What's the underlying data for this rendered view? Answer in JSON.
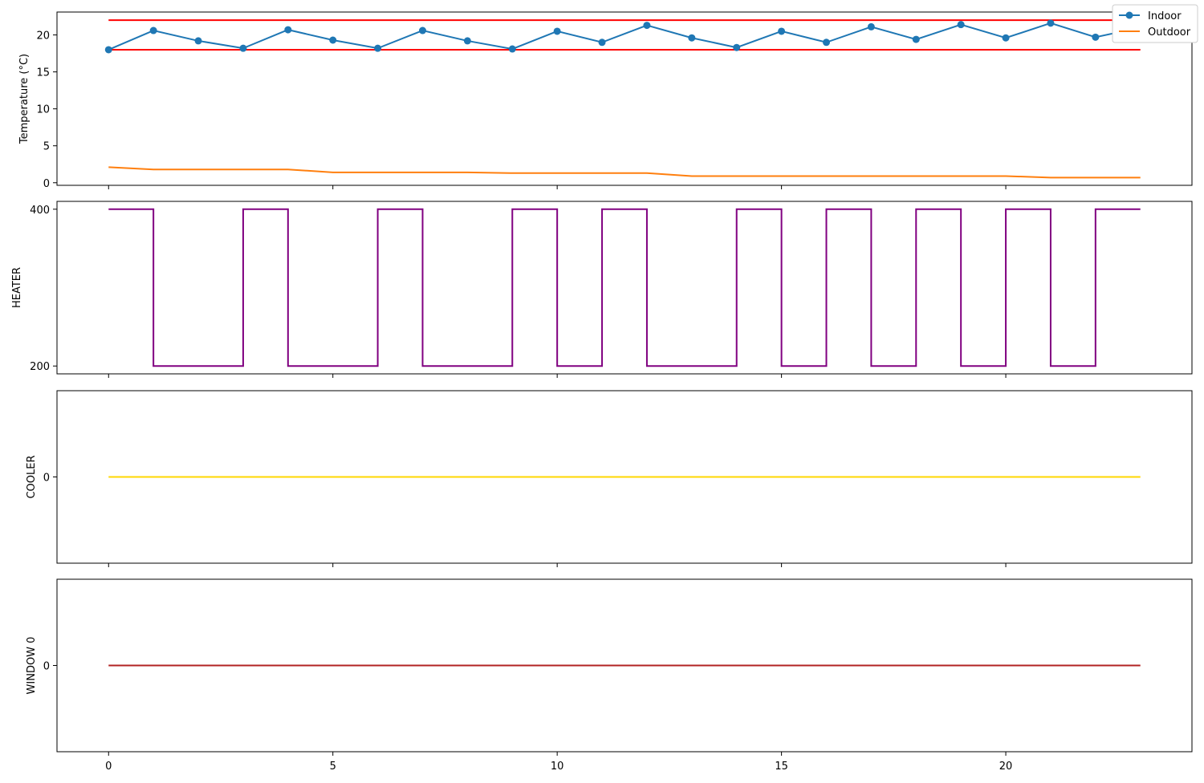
{
  "chart_data": [
    {
      "type": "line",
      "panel": "temperature",
      "ylabel": "Temperature (°C)",
      "xlabel": "",
      "xlim": [
        -1.15,
        24.15
      ],
      "ylim": [
        -0.35,
        23.1
      ],
      "x_ticks": [
        0,
        5,
        10,
        15,
        20
      ],
      "y_ticks": [
        0,
        5,
        10,
        15,
        20
      ],
      "show_x_tick_labels": false,
      "legend_position": "top-right",
      "grid": false,
      "x": [
        0,
        1,
        2,
        3,
        4,
        5,
        6,
        7,
        8,
        9,
        10,
        11,
        12,
        13,
        14,
        15,
        16,
        17,
        18,
        19,
        20,
        21,
        22,
        23
      ],
      "series": [
        {
          "name": "Indoor",
          "color": "#1f77b4",
          "marker": "circle",
          "values": [
            18.0,
            20.6,
            19.2,
            18.2,
            20.7,
            19.3,
            18.2,
            20.6,
            19.2,
            18.1,
            20.5,
            19.0,
            21.3,
            19.6,
            18.3,
            20.5,
            19.0,
            21.1,
            19.4,
            21.4,
            19.6,
            21.6,
            19.7,
            21.0
          ]
        },
        {
          "name": "Outdoor",
          "color": "#ff7f0e",
          "values": [
            2.1,
            1.8,
            1.8,
            1.8,
            1.8,
            1.4,
            1.4,
            1.4,
            1.4,
            1.3,
            1.3,
            1.3,
            1.3,
            0.9,
            0.9,
            0.9,
            0.9,
            0.9,
            0.9,
            0.9,
            0.9,
            0.7,
            0.7,
            0.7
          ]
        }
      ],
      "reference_lines": [
        {
          "y": 22,
          "color": "#ff0000"
        },
        {
          "y": 18,
          "color": "#ff0000"
        }
      ]
    },
    {
      "type": "line",
      "panel": "heater",
      "step": "post",
      "ylabel": "HEATER",
      "xlabel": "",
      "xlim": [
        -1.15,
        24.15
      ],
      "ylim": [
        190,
        410
      ],
      "x_ticks": [
        0,
        5,
        10,
        15,
        20
      ],
      "y_ticks": [
        200,
        400
      ],
      "show_x_tick_labels": false,
      "grid": false,
      "x": [
        0,
        1,
        2,
        3,
        4,
        5,
        6,
        7,
        8,
        9,
        10,
        11,
        12,
        13,
        14,
        15,
        16,
        17,
        18,
        19,
        20,
        21,
        22,
        23
      ],
      "series": [
        {
          "color": "#800080",
          "values": [
            400,
            200,
            200,
            400,
            200,
            200,
            400,
            200,
            200,
            400,
            200,
            400,
            200,
            200,
            400,
            200,
            400,
            200,
            400,
            200,
            400,
            200,
            400,
            400
          ]
        }
      ]
    },
    {
      "type": "line",
      "panel": "cooler",
      "ylabel": "COOLER",
      "xlabel": "",
      "xlim": [
        -1.15,
        24.15
      ],
      "ylim": [
        -0.055,
        0.055
      ],
      "x_ticks": [
        0,
        5,
        10,
        15,
        20
      ],
      "y_ticks": [
        0
      ],
      "show_x_tick_labels": false,
      "grid": false,
      "x": [
        0,
        1,
        2,
        3,
        4,
        5,
        6,
        7,
        8,
        9,
        10,
        11,
        12,
        13,
        14,
        15,
        16,
        17,
        18,
        19,
        20,
        21,
        22,
        23
      ],
      "series": [
        {
          "color": "#ffd700",
          "values": [
            0,
            0,
            0,
            0,
            0,
            0,
            0,
            0,
            0,
            0,
            0,
            0,
            0,
            0,
            0,
            0,
            0,
            0,
            0,
            0,
            0,
            0,
            0,
            0
          ]
        }
      ]
    },
    {
      "type": "line",
      "panel": "window",
      "ylabel": "WINDOW 0",
      "xlabel": "",
      "xlim": [
        -1.15,
        24.15
      ],
      "ylim": [
        -0.055,
        0.055
      ],
      "x_ticks": [
        0,
        5,
        10,
        15,
        20
      ],
      "y_ticks": [
        0
      ],
      "show_x_tick_labels": true,
      "grid": false,
      "x": [
        0,
        1,
        2,
        3,
        4,
        5,
        6,
        7,
        8,
        9,
        10,
        11,
        12,
        13,
        14,
        15,
        16,
        17,
        18,
        19,
        20,
        21,
        22,
        23
      ],
      "series": [
        {
          "color": "#b22222",
          "values": [
            0,
            0,
            0,
            0,
            0,
            0,
            0,
            0,
            0,
            0,
            0,
            0,
            0,
            0,
            0,
            0,
            0,
            0,
            0,
            0,
            0,
            0,
            0,
            0
          ]
        }
      ]
    }
  ]
}
